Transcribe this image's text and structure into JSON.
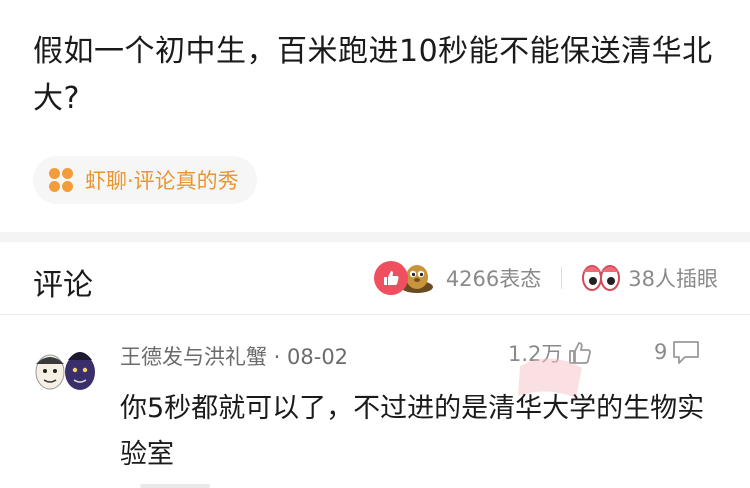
{
  "post": {
    "title": "假如一个初中生，百米跑进10秒能不能保送清华北大?"
  },
  "topic": {
    "icon": "four-dots-icon",
    "label": "虾聊·评论真的秀"
  },
  "comments_section": {
    "title": "评论",
    "reactions_count": "4266表态",
    "viewers_count": "38人插眼",
    "icons": [
      "thumbs-up-icon",
      "mole-icon",
      "eyes-icon"
    ]
  },
  "comment": {
    "user": "王德发与洪礼蟹 · 08-02",
    "likes": "1.2万",
    "replies": "9",
    "text": "你5秒都就可以了，不过进的是清华大学的生物实验室"
  },
  "colors": {
    "accent_orange": "#e8962f",
    "like_red": "#ef4f5f",
    "text_dark": "#1a1a1a",
    "text_gray": "#8a8a8a"
  }
}
